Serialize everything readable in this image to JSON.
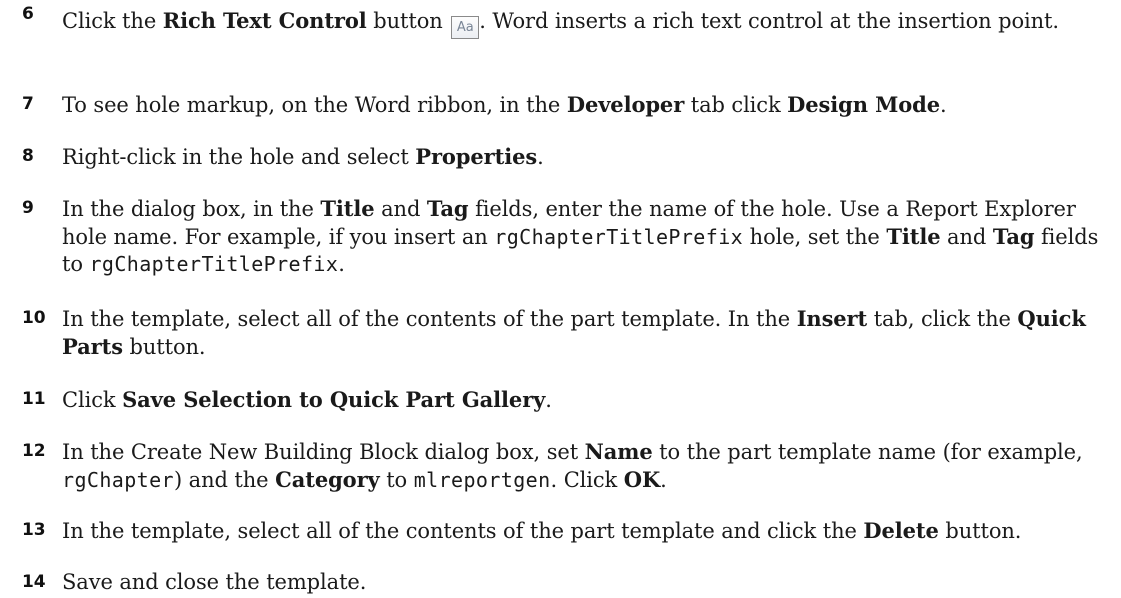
{
  "icons": {
    "rich_text_control": "Aa"
  },
  "steps": [
    {
      "number": "6",
      "parts": [
        "Click the ",
        "Rich Text Control",
        " button ",
        ". Word inserts a rich text control at the insertion point."
      ]
    },
    {
      "number": "7",
      "parts": [
        "To see hole markup, on the Word ribbon, in the ",
        "Developer",
        " tab click ",
        "Design Mode",
        "."
      ]
    },
    {
      "number": "8",
      "parts": [
        "Right-click in the hole and select ",
        "Properties",
        "."
      ]
    },
    {
      "number": "9",
      "parts": [
        "In the dialog box, in the ",
        "Title",
        " and ",
        "Tag",
        " fields, enter the name of the hole. Use a Report Explorer hole name. For example, if you insert an ",
        "rgChapterTitlePrefix",
        " hole, set the ",
        "Title",
        " and ",
        "Tag",
        " fields to ",
        "rgChapterTitlePrefix",
        "."
      ]
    },
    {
      "number": "10",
      "parts": [
        "In the template, select all of the contents of the part template. In the ",
        "Insert",
        " tab, click the ",
        "Quick Parts",
        " button."
      ]
    },
    {
      "number": "11",
      "parts": [
        "Click ",
        "Save Selection to Quick Part Gallery",
        "."
      ]
    },
    {
      "number": "12",
      "parts": [
        "In the Create New Building Block dialog box, set ",
        "Name",
        " to the part template name (for example, ",
        "rgChapter",
        ") and the ",
        "Category",
        " to ",
        "mlreportgen",
        ". Click ",
        "OK",
        "."
      ]
    },
    {
      "number": "13",
      "parts": [
        "In the template, select all of the contents of the part template and click the ",
        "Delete",
        " button."
      ]
    },
    {
      "number": "14",
      "parts": [
        "Save and close the template."
      ]
    }
  ]
}
